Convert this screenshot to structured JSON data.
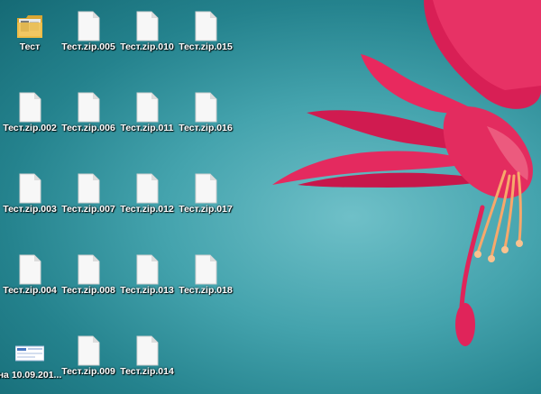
{
  "desktop": {
    "icons": [
      {
        "label": "Тест",
        "type": "folder"
      },
      {
        "label": "Тест.zip.005",
        "type": "file"
      },
      {
        "label": "Тест.zip.010",
        "type": "file"
      },
      {
        "label": "Тест.zip.015",
        "type": "file"
      },
      {
        "label": "Тест.zip.002",
        "type": "file"
      },
      {
        "label": "Тест.zip.006",
        "type": "file"
      },
      {
        "label": "Тест.zip.011",
        "type": "file"
      },
      {
        "label": "Тест.zip.016",
        "type": "file"
      },
      {
        "label": "Тест.zip.003",
        "type": "file"
      },
      {
        "label": "Тест.zip.007",
        "type": "file"
      },
      {
        "label": "Тест.zip.012",
        "type": "file"
      },
      {
        "label": "Тест.zip.017",
        "type": "file"
      },
      {
        "label": "Тест.zip.004",
        "type": "file"
      },
      {
        "label": "Тест.zip.008",
        "type": "file"
      },
      {
        "label": "Тест.zip.013",
        "type": "file"
      },
      {
        "label": "Тест.zip.018",
        "type": "file"
      },
      {
        "label": "на 10.09.201...",
        "type": "image"
      },
      {
        "label": "Тест.zip.009",
        "type": "file"
      },
      {
        "label": "Тест.zip.014",
        "type": "file"
      }
    ]
  },
  "colors": {
    "wallpaper_teal": "#3f9ea8",
    "flower_magenta": "#e0245a",
    "stamen_orange": "#f7a86b",
    "folder_yellow": "#f2c14b",
    "label_text": "#ffffff"
  }
}
